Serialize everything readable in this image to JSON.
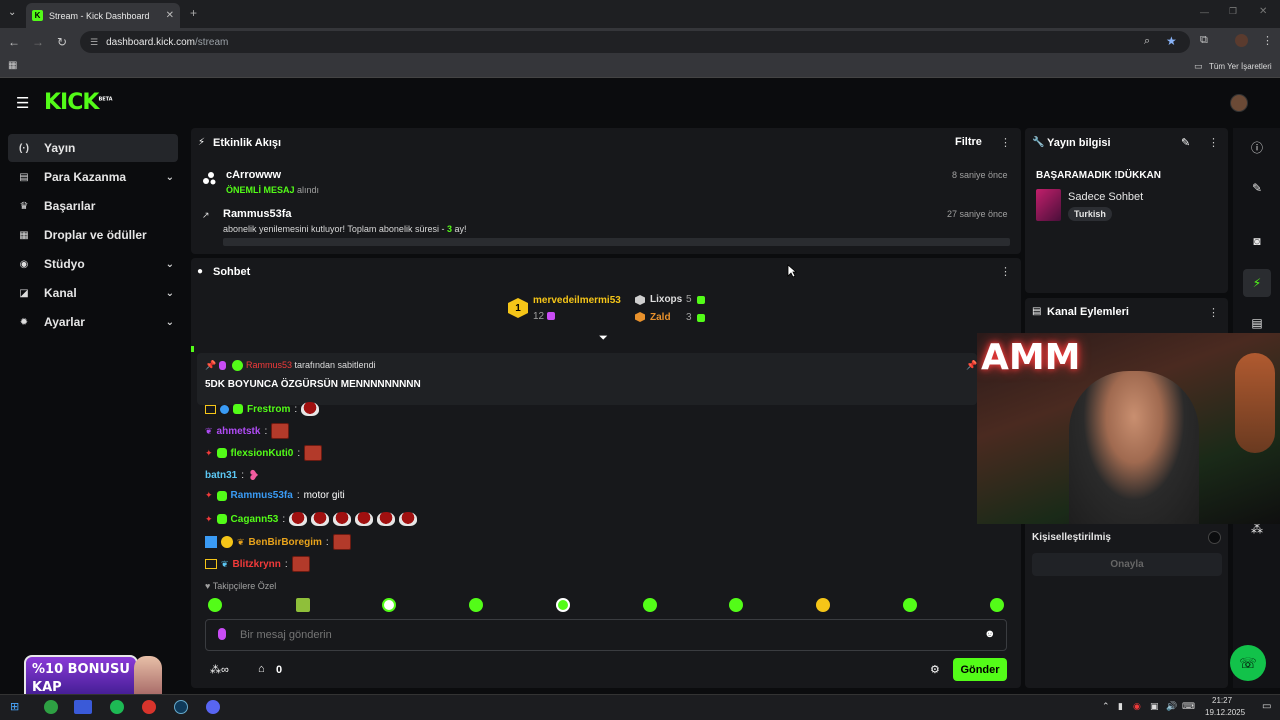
{
  "browser": {
    "tab_title": "Stream - Kick Dashboard",
    "tab_fav": "K",
    "url_host": "dashboard.kick.com",
    "url_path": "/stream",
    "bookmarks_label": "Tüm Yer İşaretleri"
  },
  "brand": {
    "logo": "KICK",
    "beta": "BETA"
  },
  "sidebar": {
    "items": [
      {
        "label": "Yayın",
        "icon": "broadcast-icon",
        "glyph": "(·)"
      },
      {
        "label": "Para Kazanma",
        "icon": "money-icon",
        "glyph": "▤"
      },
      {
        "label": "Başarılar",
        "icon": "trophy-icon",
        "glyph": "♛"
      },
      {
        "label": "Droplar ve ödüller",
        "icon": "gift-icon",
        "glyph": "▦"
      },
      {
        "label": "Stüdyo",
        "icon": "studio-icon",
        "glyph": "◉"
      },
      {
        "label": "Kanal",
        "icon": "channel-icon",
        "glyph": "◪"
      },
      {
        "label": "Ayarlar",
        "icon": "settings-icon",
        "glyph": "✹"
      }
    ]
  },
  "activity": {
    "title": "Etkinlik Akışı",
    "filter": "Filtre",
    "events": [
      {
        "user": "cArrowww",
        "highlight": "ÖNEMLİ MESAJ",
        "text": " alındı",
        "time": "8 saniye önce"
      },
      {
        "user": "Rammus53fa",
        "text": "abonelik yenilemesini kutluyor! Toplam abonelik süresi - ",
        "count": "3",
        "suffix": " ay!",
        "time": "27 saniye önce"
      }
    ]
  },
  "chat": {
    "title": "Sohbet",
    "leaders": [
      {
        "rank": "1",
        "name": "mervedeilmermi53",
        "value": "12"
      },
      {
        "name": "Lixops",
        "value": "5"
      },
      {
        "name": "Zald",
        "value": "3"
      }
    ],
    "pinned": {
      "by_user": "Rammus53",
      "by_text": " tarafından sabitlendi",
      "message": "5DK BOYUNCA ÖZGÜRSÜN MENNNNNNNNN"
    },
    "messages": [
      {
        "user": "Frestrom",
        "color": "#53fc18",
        "text": ""
      },
      {
        "user": "ahmetstk",
        "color": "#b04cf5",
        "text": ""
      },
      {
        "user": "flexsionKuti0",
        "color": "#53fc18",
        "text": ""
      },
      {
        "user": "batn31",
        "color": "#5cc8f5",
        "text": ""
      },
      {
        "user": "Rammus53fa",
        "color": "#3a9bf5",
        "text": "motor giti"
      },
      {
        "user": "Cagann53",
        "color": "#53fc18",
        "text": ""
      },
      {
        "user": "BenBirBoregim",
        "color": "#e8a31c",
        "text": ""
      },
      {
        "user": "Blitzkrynn",
        "color": "#f23a3a",
        "text": ""
      }
    ],
    "followers_only": "Takipçilere Özel",
    "input_placeholder": "Bir mesaj gönderin",
    "points": "0",
    "send": "Gönder"
  },
  "stream_info": {
    "title": "Yayın bilgisi",
    "stream_title": "BAŞARAMADIK !DÜKKAN",
    "category": "Sadece Sohbet",
    "language": "Turkish"
  },
  "channel_actions": {
    "title": "Kanal Eylemleri",
    "custom_label": "Kişiselleştirilmiş",
    "approve": "Onayla"
  },
  "overlay": {
    "bonus_line1": "%10 BONUSU",
    "bonus_line2": "KAP",
    "webcam_text": "AMM"
  },
  "taskbar": {
    "time": "21:27",
    "date": "19.12.2025"
  }
}
